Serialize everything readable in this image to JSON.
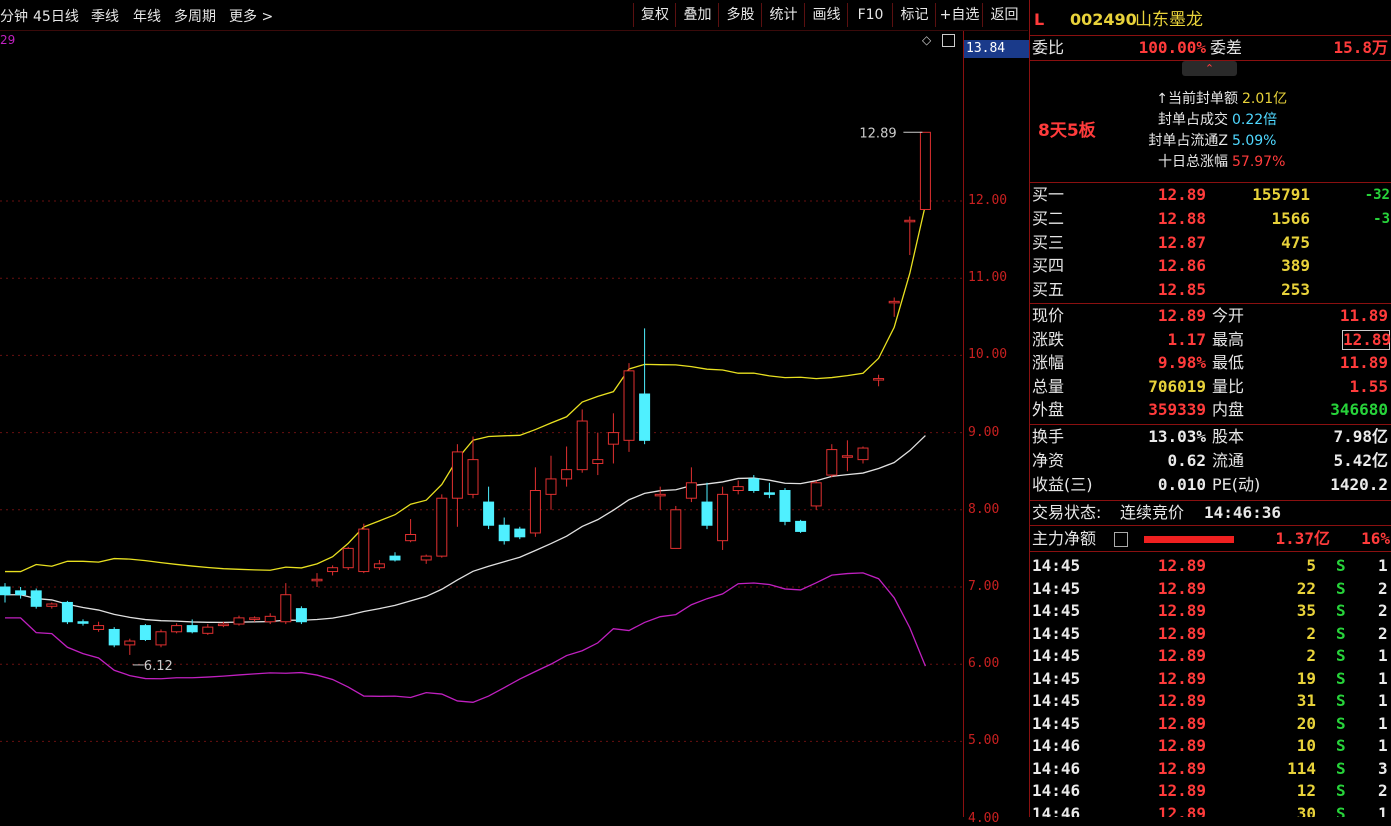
{
  "toolbar": {
    "period_tabs": [
      "分钟",
      "45日线",
      "季线",
      "年线",
      "多周期",
      "更多 >"
    ],
    "buttons": [
      "复权",
      "叠加",
      "多股",
      "统计",
      "画线",
      "F10",
      "标记",
      "+自选",
      "返回"
    ]
  },
  "chart": {
    "corner_label": "29",
    "current_price_tag": "13.84",
    "y_ticks": [
      "12.00",
      "11.00",
      "10.00",
      "9.00",
      "8.00",
      "7.00",
      "6.00",
      "5.00",
      "4.00"
    ],
    "high_annotation": "12.89",
    "low_annotation": "6.12",
    "colors": {
      "up": "#e03030",
      "down": "#4ff0ff",
      "upper_band": "#e8e020",
      "mid_band": "#e0e0e0",
      "lower_band": "#c020c0"
    },
    "candles": [
      {
        "o": 7.0,
        "c": 6.9,
        "h": 7.05,
        "l": 6.8
      },
      {
        "o": 6.95,
        "c": 6.9,
        "h": 7.0,
        "l": 6.85
      },
      {
        "o": 6.95,
        "c": 6.75,
        "h": 6.98,
        "l": 6.72
      },
      {
        "o": 6.75,
        "c": 6.78,
        "h": 6.8,
        "l": 6.72
      },
      {
        "o": 6.8,
        "c": 6.55,
        "h": 6.82,
        "l": 6.52
      },
      {
        "o": 6.55,
        "c": 6.53,
        "h": 6.58,
        "l": 6.5
      },
      {
        "o": 6.45,
        "c": 6.5,
        "h": 6.55,
        "l": 6.42
      },
      {
        "o": 6.45,
        "c": 6.25,
        "h": 6.48,
        "l": 6.22
      },
      {
        "o": 6.25,
        "c": 6.3,
        "h": 6.33,
        "l": 6.12
      },
      {
        "o": 6.5,
        "c": 6.32,
        "h": 6.52,
        "l": 6.3
      },
      {
        "o": 6.25,
        "c": 6.42,
        "h": 6.45,
        "l": 6.22
      },
      {
        "o": 6.42,
        "c": 6.5,
        "h": 6.53,
        "l": 6.4
      },
      {
        "o": 6.5,
        "c": 6.42,
        "h": 6.58,
        "l": 6.4
      },
      {
        "o": 6.4,
        "c": 6.48,
        "h": 6.52,
        "l": 6.38
      },
      {
        "o": 6.5,
        "c": 6.52,
        "h": 6.55,
        "l": 6.48
      },
      {
        "o": 6.52,
        "c": 6.6,
        "h": 6.63,
        "l": 6.5
      },
      {
        "o": 6.58,
        "c": 6.6,
        "h": 6.62,
        "l": 6.55
      },
      {
        "o": 6.55,
        "c": 6.62,
        "h": 6.66,
        "l": 6.52
      },
      {
        "o": 6.55,
        "c": 6.9,
        "h": 7.05,
        "l": 6.52
      },
      {
        "o": 6.72,
        "c": 6.55,
        "h": 6.75,
        "l": 6.52
      },
      {
        "o": 7.1,
        "c": 7.1,
        "h": 7.18,
        "l": 7.0
      },
      {
        "o": 7.2,
        "c": 7.25,
        "h": 7.28,
        "l": 7.15
      },
      {
        "o": 7.25,
        "c": 7.5,
        "h": 7.52,
        "l": 7.22
      },
      {
        "o": 7.2,
        "c": 7.75,
        "h": 7.82,
        "l": 7.18
      },
      {
        "o": 7.25,
        "c": 7.3,
        "h": 7.35,
        "l": 7.22
      },
      {
        "o": 7.4,
        "c": 7.35,
        "h": 7.45,
        "l": 7.33
      },
      {
        "o": 7.6,
        "c": 7.68,
        "h": 7.88,
        "l": 7.58
      },
      {
        "o": 7.35,
        "c": 7.4,
        "h": 7.42,
        "l": 7.3
      },
      {
        "o": 7.4,
        "c": 8.15,
        "h": 8.2,
        "l": 7.38
      },
      {
        "o": 8.15,
        "c": 8.75,
        "h": 8.85,
        "l": 7.78
      },
      {
        "o": 8.2,
        "c": 8.65,
        "h": 8.95,
        "l": 8.15
      },
      {
        "o": 8.1,
        "c": 7.8,
        "h": 8.3,
        "l": 7.75
      },
      {
        "o": 7.8,
        "c": 7.6,
        "h": 7.9,
        "l": 7.55
      },
      {
        "o": 7.75,
        "c": 7.65,
        "h": 7.78,
        "l": 7.62
      },
      {
        "o": 7.7,
        "c": 8.25,
        "h": 8.55,
        "l": 7.65
      },
      {
        "o": 8.2,
        "c": 8.4,
        "h": 8.7,
        "l": 8.0
      },
      {
        "o": 8.4,
        "c": 8.52,
        "h": 8.82,
        "l": 8.3
      },
      {
        "o": 8.52,
        "c": 9.15,
        "h": 9.3,
        "l": 8.48
      },
      {
        "o": 8.6,
        "c": 8.65,
        "h": 9.0,
        "l": 8.45
      },
      {
        "o": 8.85,
        "c": 9.0,
        "h": 9.25,
        "l": 8.6
      },
      {
        "o": 8.9,
        "c": 9.8,
        "h": 9.9,
        "l": 8.75
      },
      {
        "o": 9.5,
        "c": 8.9,
        "h": 10.35,
        "l": 8.85
      },
      {
        "o": 8.2,
        "c": 8.2,
        "h": 8.3,
        "l": 8.0
      },
      {
        "o": 7.5,
        "c": 8.0,
        "h": 8.05,
        "l": 7.5
      },
      {
        "o": 8.15,
        "c": 8.35,
        "h": 8.55,
        "l": 8.1
      },
      {
        "o": 8.1,
        "c": 7.8,
        "h": 8.35,
        "l": 7.75
      },
      {
        "o": 7.6,
        "c": 8.2,
        "h": 8.3,
        "l": 7.48
      },
      {
        "o": 8.25,
        "c": 8.3,
        "h": 8.38,
        "l": 8.2
      },
      {
        "o": 8.4,
        "c": 8.25,
        "h": 8.45,
        "l": 8.22
      },
      {
        "o": 8.22,
        "c": 8.2,
        "h": 8.35,
        "l": 8.15
      },
      {
        "o": 8.25,
        "c": 7.85,
        "h": 8.28,
        "l": 7.8
      },
      {
        "o": 7.85,
        "c": 7.72,
        "h": 7.87,
        "l": 7.7
      },
      {
        "o": 8.05,
        "c": 8.35,
        "h": 8.38,
        "l": 8.0
      },
      {
        "o": 8.45,
        "c": 8.78,
        "h": 8.85,
        "l": 8.42
      },
      {
        "o": 8.7,
        "c": 8.7,
        "h": 8.9,
        "l": 8.5
      },
      {
        "o": 8.65,
        "c": 8.8,
        "h": 8.82,
        "l": 8.6
      },
      {
        "o": 9.7,
        "c": 9.7,
        "h": 9.75,
        "l": 9.6
      },
      {
        "o": 10.7,
        "c": 10.7,
        "h": 10.75,
        "l": 10.5
      },
      {
        "o": 11.75,
        "c": 11.75,
        "h": 11.8,
        "l": 11.3
      },
      {
        "o": 11.89,
        "c": 12.89,
        "h": 12.89,
        "l": 11.89
      }
    ]
  },
  "quote": {
    "header": {
      "code_prefix": "L",
      "code": "002490",
      "name": "山东墨龙"
    },
    "wb_label": "委比",
    "wb_value": "100.00%",
    "wc_label": "委差",
    "wc_value": "15.8万",
    "board_tag": "8天5板",
    "seal": [
      {
        "label": "↑当前封单额",
        "value": "2.01亿",
        "color": "yellow"
      },
      {
        "label": "封单占成交",
        "value": "0.22倍",
        "color": "cyan"
      },
      {
        "label": "封单占流通Z",
        "value": "5.09%",
        "color": "cyan"
      },
      {
        "label": "十日总涨幅",
        "value": "57.97%",
        "color": "red"
      }
    ],
    "bids": [
      {
        "label": "买一",
        "price": "12.89",
        "vol": "155791",
        "chg": "-32"
      },
      {
        "label": "买二",
        "price": "12.88",
        "vol": "1566",
        "chg": "-3"
      },
      {
        "label": "买三",
        "price": "12.87",
        "vol": "475",
        "chg": ""
      },
      {
        "label": "买四",
        "price": "12.86",
        "vol": "389",
        "chg": ""
      },
      {
        "label": "买五",
        "price": "12.85",
        "vol": "253",
        "chg": ""
      }
    ],
    "stats": [
      {
        "l1": "现价",
        "v1": "12.89",
        "c1": "red",
        "l2": "今开",
        "v2": "11.89",
        "c2": "red"
      },
      {
        "l1": "涨跌",
        "v1": "1.17",
        "c1": "red",
        "l2": "最高",
        "v2": "12.89",
        "c2": "red"
      },
      {
        "l1": "涨幅",
        "v1": "9.98%",
        "c1": "red",
        "l2": "最低",
        "v2": "11.89",
        "c2": "red"
      },
      {
        "l1": "总量",
        "v1": "706019",
        "c1": "yellow",
        "l2": "量比",
        "v2": "1.55",
        "c2": "red"
      },
      {
        "l1": "外盘",
        "v1": "359339",
        "c1": "red",
        "l2": "内盘",
        "v2": "346680",
        "c2": "green"
      }
    ],
    "fundamentals": [
      {
        "l1": "换手",
        "v1": "13.03%",
        "l2": "股本",
        "v2": "7.98亿"
      },
      {
        "l1": "净资",
        "v1": "0.62",
        "l2": "流通",
        "v2": "5.42亿"
      },
      {
        "l1": "收益(三)",
        "v1": "0.010",
        "l2": "PE(动)",
        "v2": "1420.2"
      }
    ],
    "trade_status_label": "交易状态:",
    "trade_status": "连续竞价",
    "trade_time": "14:46:36",
    "main_flow_label": "主力净额",
    "main_flow_value": "1.37亿",
    "main_flow_pct": "16%",
    "ticks": [
      {
        "t": "14:45",
        "p": "12.89",
        "v": "5",
        "s": "S",
        "n": "1"
      },
      {
        "t": "14:45",
        "p": "12.89",
        "v": "22",
        "s": "S",
        "n": "2"
      },
      {
        "t": "14:45",
        "p": "12.89",
        "v": "35",
        "s": "S",
        "n": "2"
      },
      {
        "t": "14:45",
        "p": "12.89",
        "v": "2",
        "s": "S",
        "n": "2"
      },
      {
        "t": "14:45",
        "p": "12.89",
        "v": "2",
        "s": "S",
        "n": "1"
      },
      {
        "t": "14:45",
        "p": "12.89",
        "v": "19",
        "s": "S",
        "n": "1"
      },
      {
        "t": "14:45",
        "p": "12.89",
        "v": "31",
        "s": "S",
        "n": "1"
      },
      {
        "t": "14:45",
        "p": "12.89",
        "v": "20",
        "s": "S",
        "n": "1"
      },
      {
        "t": "14:46",
        "p": "12.89",
        "v": "10",
        "s": "S",
        "n": "1"
      },
      {
        "t": "14:46",
        "p": "12.89",
        "v": "114",
        "s": "S",
        "n": "3"
      },
      {
        "t": "14:46",
        "p": "12.89",
        "v": "12",
        "s": "S",
        "n": "2"
      },
      {
        "t": "14:46",
        "p": "12.89",
        "v": "30",
        "s": "S",
        "n": "1"
      }
    ]
  }
}
